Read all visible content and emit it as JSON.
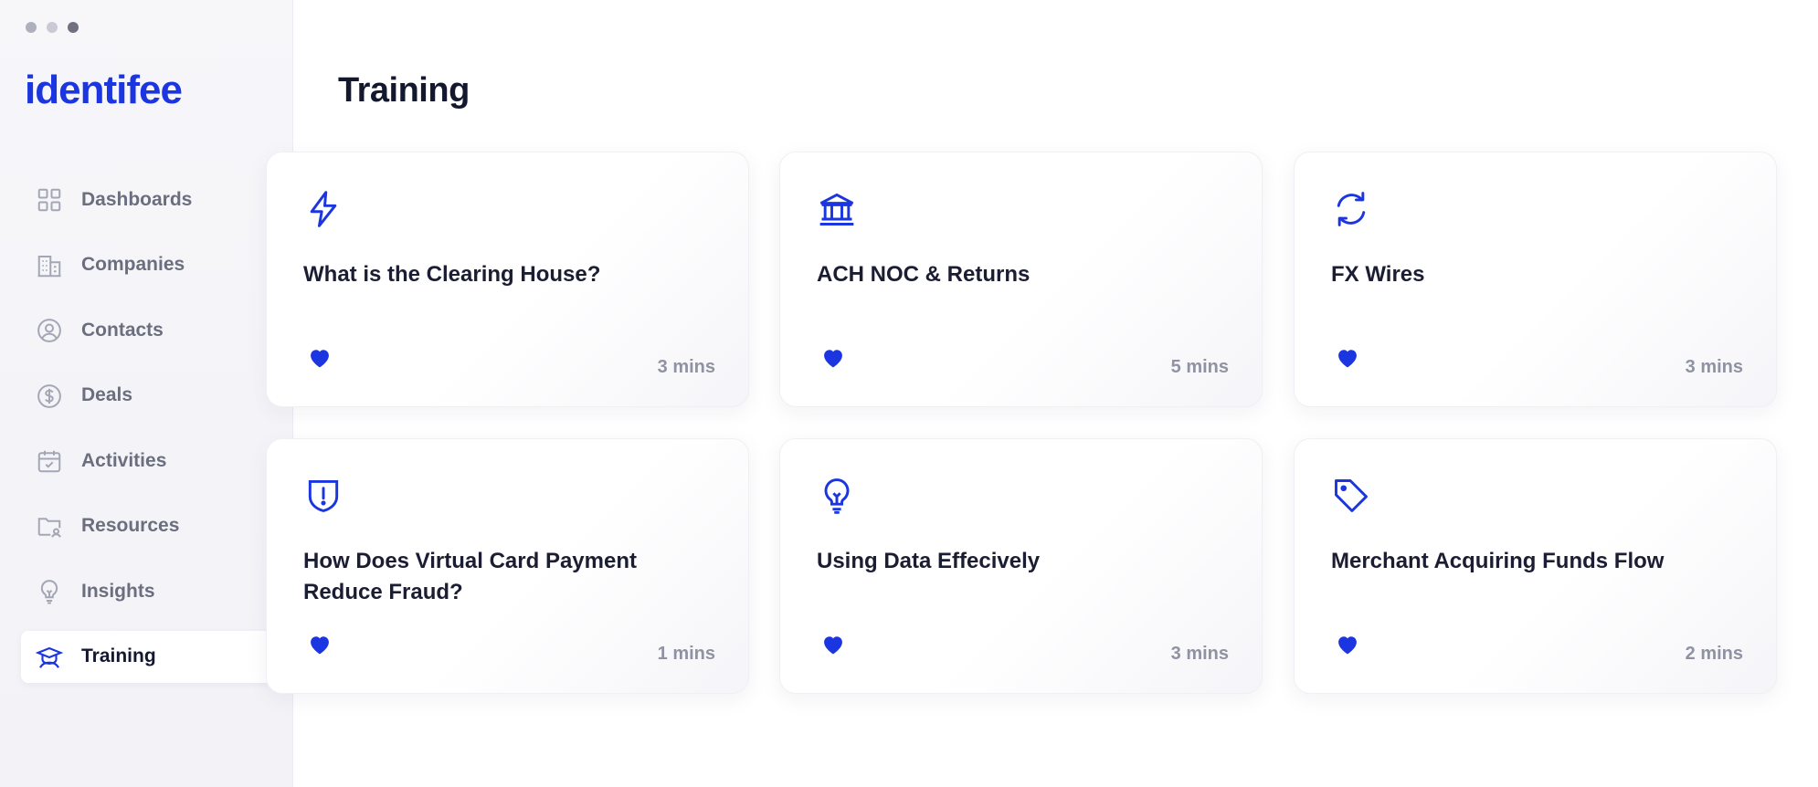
{
  "window_controls": [
    "close",
    "minimize",
    "maximize"
  ],
  "logo": "identifee",
  "sidebar": {
    "items": [
      {
        "label": "Dashboards",
        "icon": "dashboard-grid-icon",
        "active": false
      },
      {
        "label": "Companies",
        "icon": "building-icon",
        "active": false
      },
      {
        "label": "Contacts",
        "icon": "user-circle-icon",
        "active": false
      },
      {
        "label": "Deals",
        "icon": "dollar-circle-icon",
        "active": false
      },
      {
        "label": "Activities",
        "icon": "calendar-check-icon",
        "active": false
      },
      {
        "label": "Resources",
        "icon": "folder-user-icon",
        "active": false
      },
      {
        "label": "Insights",
        "icon": "lightbulb-icon",
        "active": false
      },
      {
        "label": "Training",
        "icon": "graduation-cap-icon",
        "active": true
      }
    ]
  },
  "main": {
    "title": "Training",
    "cards": [
      {
        "title": "What is the Clearing House?",
        "duration": "3 mins",
        "icon": "lightning-icon"
      },
      {
        "title": "ACH NOC & Returns",
        "duration": "5 mins",
        "icon": "bank-icon"
      },
      {
        "title": "FX Wires",
        "duration": "3 mins",
        "icon": "refresh-arrows-icon"
      },
      {
        "title": "How Does Virtual Card Payment Reduce Fraud?",
        "duration": "1 mins",
        "icon": "shield-alert-icon"
      },
      {
        "title": "Using Data Effecively",
        "duration": "3 mins",
        "icon": "lightbulb-icon"
      },
      {
        "title": "Merchant Acquiring Funds Flow",
        "duration": "2 mins",
        "icon": "tag-icon"
      }
    ]
  },
  "colors": {
    "accent": "#1b36e0",
    "text_primary": "#14182f",
    "text_muted": "#6b6e7e",
    "duration": "#8f92a3"
  }
}
